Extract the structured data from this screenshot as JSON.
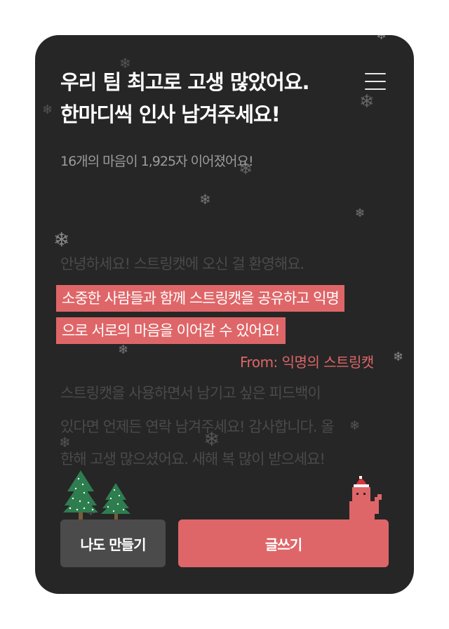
{
  "header": {
    "title_line1": "우리 팀 최고로 고생 많았어요.",
    "title_line2": "한마디씩 인사 남겨주세요!",
    "menu_icon": "hamburger-menu-icon"
  },
  "summary": "16개의 마음이 1,925자 이어졌어요!",
  "messages": {
    "intro": "안녕하세요! 스트링캣에 오신 걸 환영해요.",
    "highlight_line1": "소중한 사람들과 함께 스트링캣을 공유하고 익명",
    "highlight_line2": "으로 서로의 마음을 이어갈 수 있어요!",
    "from": "From: 익명의 스트링캣",
    "body_line1": "스트링캣을  사용하면서  남기고  싶은  피드백이",
    "body_line2": "있다면 언제든 연락 남겨주세요! 감사합니다. 올",
    "body_line3": "한해 고생 많으셨어요. 새해 복 많이 받으세요!"
  },
  "buttons": {
    "make_label": "나도 만들기",
    "write_label": "글쓰기"
  },
  "colors": {
    "card_bg": "#262626",
    "accent": "#df6668",
    "secondary_button": "#4b4b4b"
  },
  "decorations": {
    "tree_icon": "christmas-tree-icon",
    "cat_icon": "santa-cat-icon",
    "snow_icon": "snowflake-icon"
  }
}
